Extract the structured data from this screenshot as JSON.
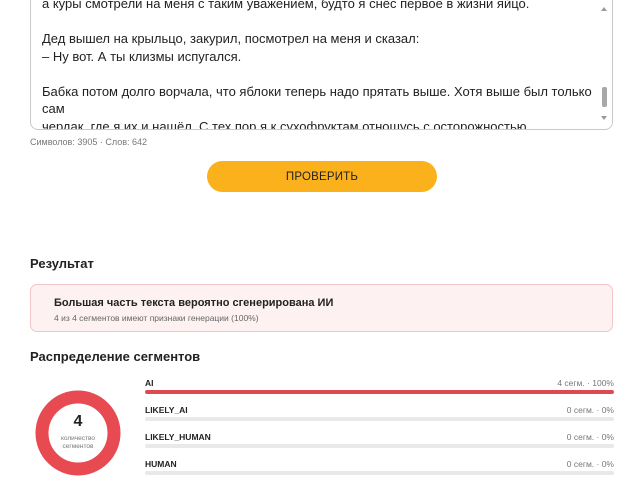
{
  "editor": {
    "lines": [
      "а куры смотрели на меня с таким уважением, будто я снёс первое в жизни яйцо.",
      "Дед вышел на крыльцо, закурил, посмотрел на меня и сказал:",
      "– Ну вот. А ты клизмы испугался.",
      "Бабка потом долго ворчала, что яблоки теперь надо прятать выше. Хотя выше был только сам",
      "чердак, где я их и нашёл. С тех пор я к сухофруктам отношусь с осторожностью."
    ]
  },
  "counter": "Символов: 3905 · Слов: 642",
  "check_button": "ПРОВЕРИТЬ",
  "result": {
    "title": "Результат",
    "verdict": "Большая часть текста вероятно сгенерирована ИИ",
    "details": "4 из 4 сегментов имеют признаки генерации (100%)"
  },
  "distribution": {
    "title": "Распределение сегментов",
    "total": "4",
    "total_label_line1": "количество",
    "total_label_line2": "сегментов",
    "donut_color": "#e84a51",
    "segments": [
      {
        "name": "AI",
        "stat": "4 сегм. · 100%",
        "fraction": 1.0,
        "color": "#dc4a4f"
      },
      {
        "name": "LIKELY_AI",
        "stat": "0 сегм. · 0%",
        "fraction": 0,
        "color": "#e9a0a0"
      },
      {
        "name": "LIKELY_HUMAN",
        "stat": "0 сегм. · 0%",
        "fraction": 0,
        "color": "#a0c4e9"
      },
      {
        "name": "HUMAN",
        "stat": "0 сегм. · 0%",
        "fraction": 0,
        "color": "#7bbf7b"
      }
    ]
  }
}
